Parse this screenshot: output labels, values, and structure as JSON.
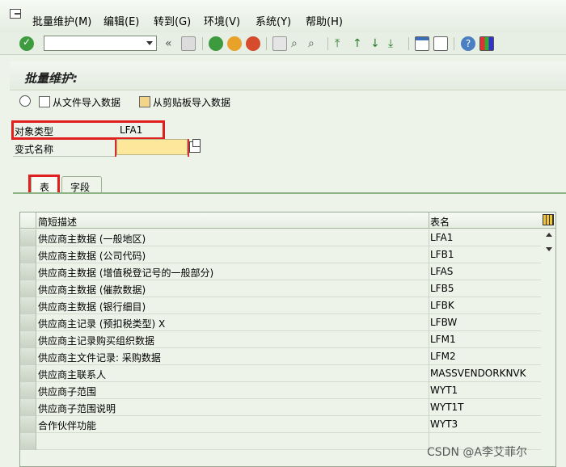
{
  "menu": {
    "items": [
      "批量维护(M)",
      "编辑(E)",
      "转到(G)",
      "环境(V)",
      "系统(Y)",
      "帮助(H)"
    ]
  },
  "toolbar": {
    "command_value": "",
    "icons": [
      "check-icon",
      "back-icon",
      "save-icon",
      "nav-back-icon",
      "exit-icon",
      "cancel-icon",
      "print-icon",
      "find-icon",
      "find-next-icon",
      "first-page-icon",
      "prev-page-icon",
      "next-page-icon",
      "last-page-icon",
      "new-session-icon",
      "shortcut-icon",
      "help-icon",
      "layout-icon"
    ]
  },
  "page": {
    "title": "批量维护:"
  },
  "app_toolbar": {
    "execute_icon": "execute-icon",
    "import_file": "从文件导入数据",
    "import_clipboard": "从剪贴板导入数据"
  },
  "form": {
    "object_type_label": "对象类型",
    "object_type_value": "LFA1",
    "variant_label": "变式名称",
    "variant_value": ""
  },
  "tabs": {
    "table": "表",
    "fields": "字段"
  },
  "table": {
    "columns": [
      "简短描述",
      "表名"
    ],
    "rows": [
      {
        "desc": "供应商主数据 (一般地区)",
        "name": "LFA1"
      },
      {
        "desc": "供应商主数据 (公司代码)",
        "name": "LFB1"
      },
      {
        "desc": "供应商主数据 (增值税登记号的一般部分)",
        "name": "LFAS"
      },
      {
        "desc": "供应商主数据 (催款数据)",
        "name": "LFB5"
      },
      {
        "desc": "供应商主数据 (银行细目)",
        "name": "LFBK"
      },
      {
        "desc": "供应商主记录 (预扣税类型) X",
        "name": "LFBW"
      },
      {
        "desc": "供应商主记录购买组织数据",
        "name": "LFM1"
      },
      {
        "desc": "供应商主文件记录: 采购数据",
        "name": "LFM2"
      },
      {
        "desc": "供应商主联系人",
        "name": "MASSVENDORKNVK"
      },
      {
        "desc": "供应商子范围",
        "name": "WYT1"
      },
      {
        "desc": "供应商子范围说明",
        "name": "WYT1T"
      },
      {
        "desc": "合作伙伴功能",
        "name": "WYT3"
      },
      {
        "desc": "",
        "name": ""
      }
    ]
  },
  "watermark": "CSDN @A李艾菲尔",
  "colors": {
    "highlight": "#e0201f",
    "required_input": "#fde79a",
    "tab_border": "#8db387"
  }
}
